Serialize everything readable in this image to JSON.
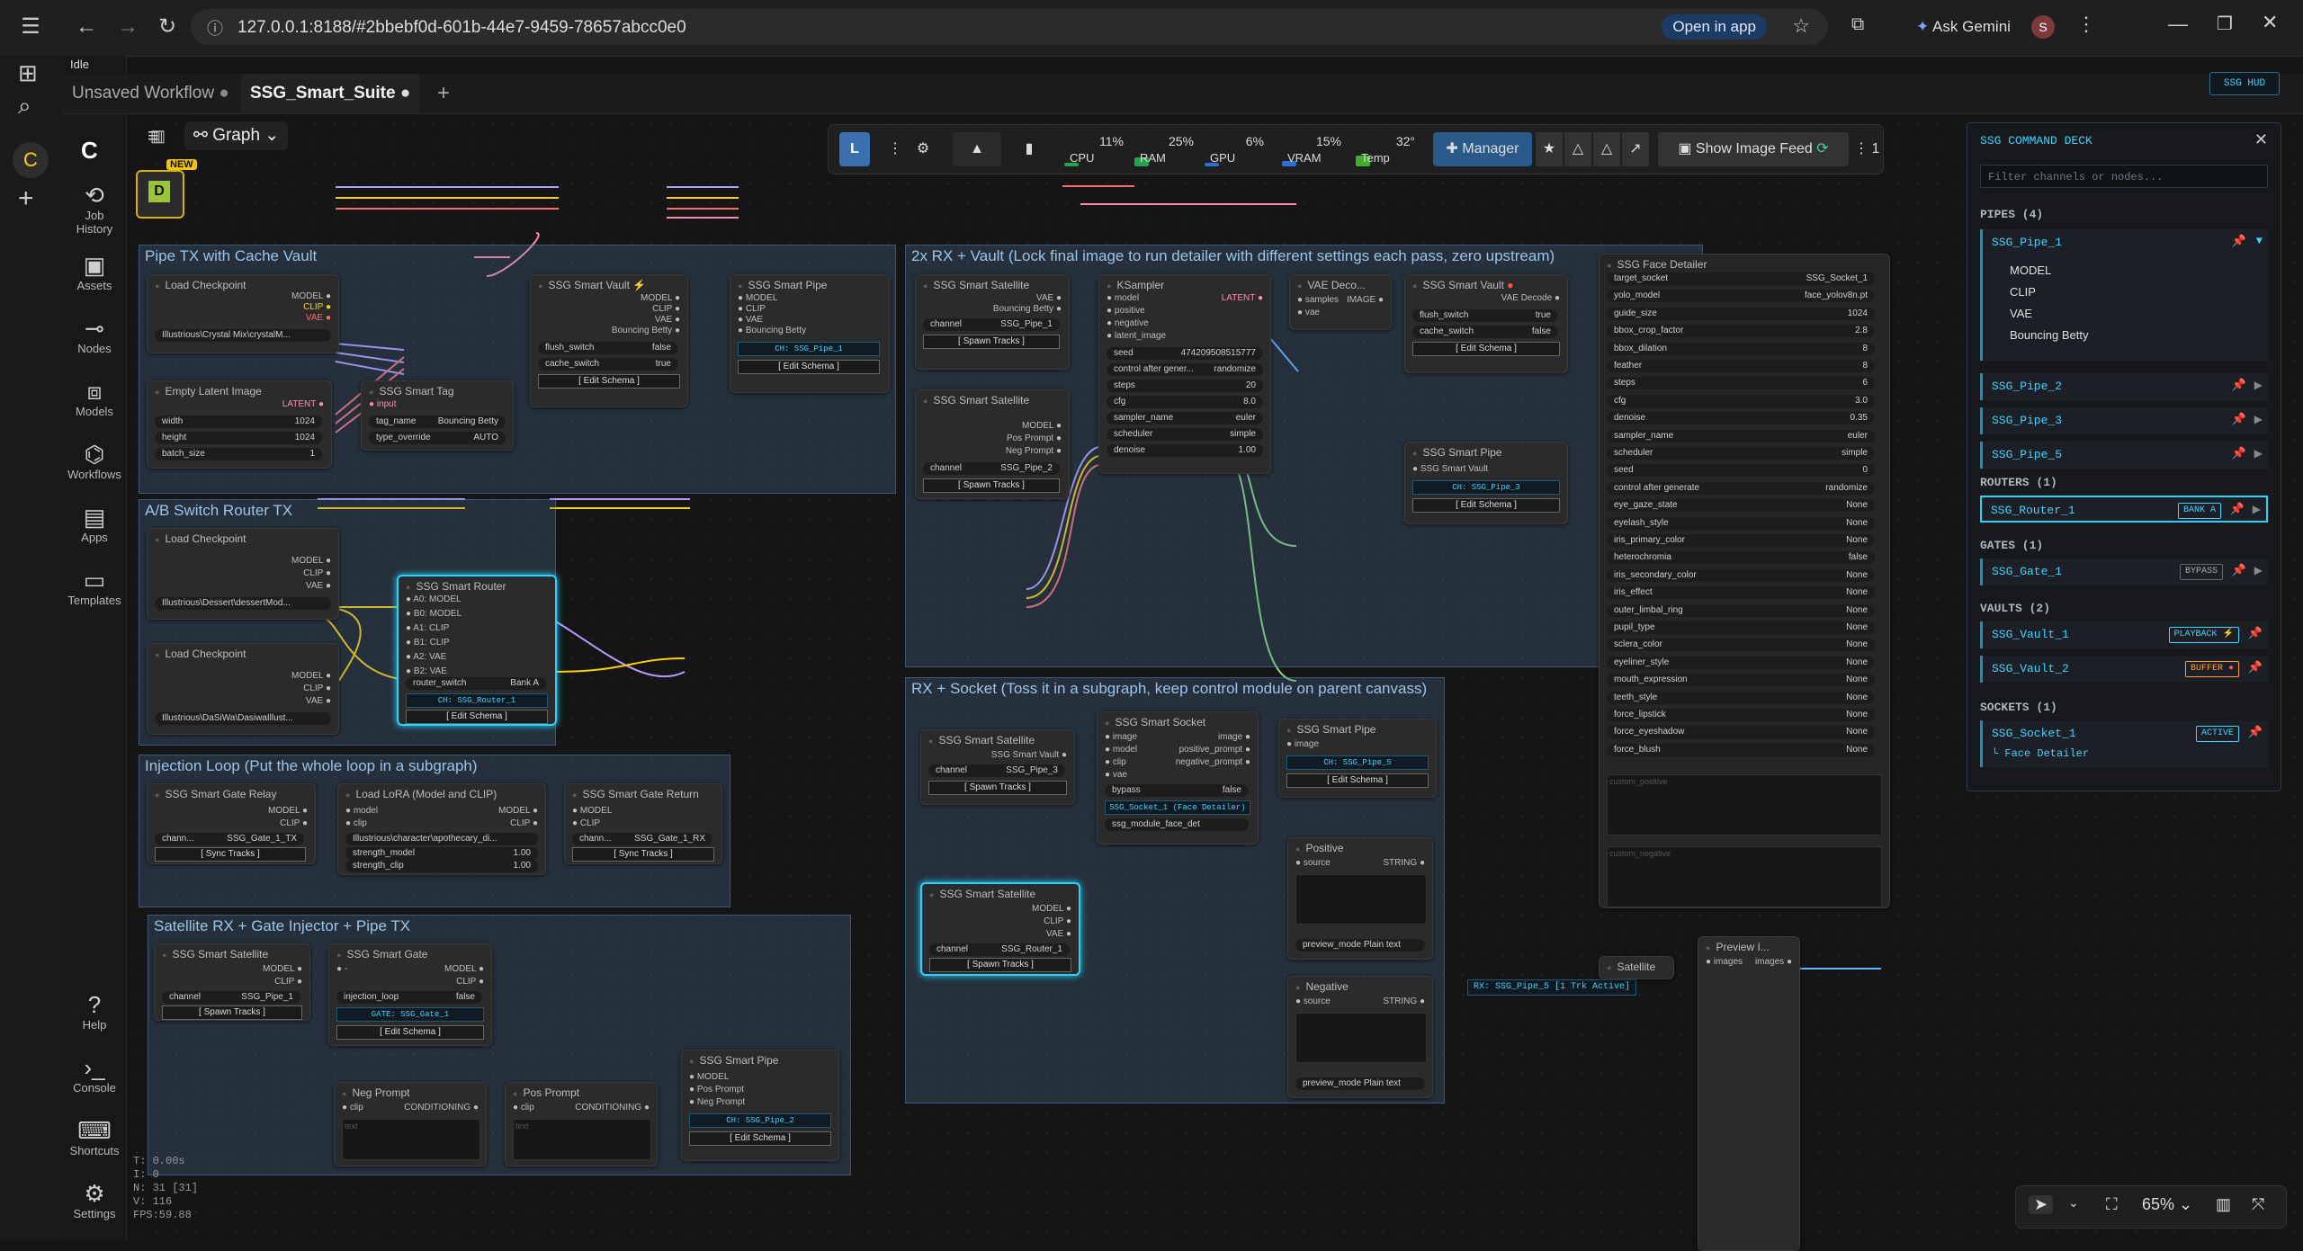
{
  "browser": {
    "url": "127.0.0.1:8188/#2bbebf0d-601b-44e7-9459-78657abcc0e0",
    "open_in_app": "Open in app",
    "ask_gemini": "Ask Gemini",
    "avatar": "S"
  },
  "status": {
    "idle": "Idle"
  },
  "tabs": [
    {
      "label": "Unsaved Workflow"
    },
    {
      "label": "SSG_Smart_Suite"
    }
  ],
  "graph_label": "Graph",
  "new_badge": "NEW",
  "sidebar": [
    {
      "label": "Job\nHistory",
      "icon": "history-icon"
    },
    {
      "label": "Assets",
      "icon": "image-icon"
    },
    {
      "label": "Nodes",
      "icon": "nodes-icon"
    },
    {
      "label": "Models",
      "icon": "models-icon"
    },
    {
      "label": "Workflows",
      "icon": "workflow-icon"
    },
    {
      "label": "Apps",
      "icon": "apps-icon"
    },
    {
      "label": "Templates",
      "icon": "templates-icon"
    },
    {
      "label": "Help",
      "icon": "help-icon"
    },
    {
      "label": "Console",
      "icon": "console-icon"
    },
    {
      "label": "Shortcuts",
      "icon": "keyboard-icon"
    },
    {
      "label": "Settings",
      "icon": "gear-icon"
    }
  ],
  "toolbar": {
    "l_label": "L",
    "cpu": {
      "label": "CPU",
      "value": "11%",
      "fill": 0.11
    },
    "ram": {
      "label": "RAM",
      "value": "25%",
      "fill": 0.25
    },
    "gpu": {
      "label": "GPU",
      "value": "6%",
      "fill": 0.06
    },
    "vram": {
      "label": "VRAM",
      "value": "15%",
      "fill": 0.15
    },
    "temp": {
      "label": "Temp",
      "value": "32°",
      "fill": 0.32
    },
    "manager": "Manager",
    "show_feed": "Show Image Feed",
    "queue": "1"
  },
  "hud": "SSG HUD",
  "groups": [
    {
      "id": "g1",
      "title": "Pipe TX with Cache Vault"
    },
    {
      "id": "g2",
      "title": "2x RX + Vault (Lock final image to run detailer with different settings each pass, zero upstream)"
    },
    {
      "id": "g3",
      "title": "A/B Switch Router TX"
    },
    {
      "id": "g4",
      "title": "Injection Loop (Put the whole loop in a subgraph)"
    },
    {
      "id": "g5",
      "title": "RX + Socket (Toss it in a subgraph, keep control module on parent canvass)"
    },
    {
      "id": "g6",
      "title": "Satellite RX + Gate Injector + Pipe TX"
    }
  ],
  "nodes": {
    "lc1": {
      "title": "Load Checkpoint",
      "ckpt": "Illustrious\\Crystal Mix\\crystalM..."
    },
    "empty": {
      "title": "Empty Latent Image",
      "width": "1024",
      "height": "1024",
      "batch": "1"
    },
    "tag": {
      "title": "SSG Smart Tag",
      "tag_name": "Bouncing Betty",
      "type_override": "AUTO"
    },
    "vault1": {
      "title": "SSG Smart Vault",
      "flush": "false",
      "cache": "true",
      "schema": "[ Edit Schema ]"
    },
    "pipe1": {
      "title": "SSG Smart Pipe",
      "ch": "CH: SSG_Pipe_1",
      "schema": "[ Edit Schema ]"
    },
    "sat_a": {
      "title": "SSG Smart Satellite",
      "channel": "SSG_Pipe_1",
      "spawn": "[ Spawn Tracks ]"
    },
    "sat_b": {
      "title": "SSG Smart Satellite",
      "channel": "SSG_Pipe_2",
      "spawn": "[ Spawn Tracks ]"
    },
    "ksampler": {
      "title": "KSampler",
      "seed": "474209508515777",
      "control": "randomize",
      "steps": "20",
      "cfg": "8.0",
      "sampler": "euler",
      "scheduler": "simple",
      "denoise": "1.00"
    },
    "vaedec": {
      "title": "VAE Deco..."
    },
    "vault2": {
      "title": "SSG Smart Vault",
      "flush": "true",
      "cache": "false",
      "schema": "[ Edit Schema ]"
    },
    "pipe3": {
      "title": "SSG Smart Pipe",
      "ch": "CH: SSG_Pipe_3",
      "schema": "[ Edit Schema ]"
    },
    "lc2": {
      "title": "Load Checkpoint",
      "ckpt": "Illustrious\\Dessert\\dessertMod..."
    },
    "lc3": {
      "title": "Load Checkpoint",
      "ckpt": "Illustrious\\DaSiWa\\DasiwaIllust..."
    },
    "router": {
      "title": "SSG Smart Router",
      "switch": "Bank A",
      "ch": "CH: SSG_Router_1",
      "schema": "[ Edit Schema ]"
    },
    "relay": {
      "title": "SSG Smart Gate Relay",
      "channel": "SSG_Gate_1_TX",
      "sync": "[ Sync Tracks ]"
    },
    "lora": {
      "title": "Load LoRA (Model and CLIP)",
      "lora": "Illustrious\\character\\apothecary_di...",
      "sm": "1.00",
      "sc": "1.00"
    },
    "gret": {
      "title": "SSG Smart Gate Return",
      "channel": "SSG_Gate_1_RX",
      "sync": "[ Sync Tracks ]"
    },
    "sat_c": {
      "title": "SSG Smart Satellite",
      "channel": "SSG_Pipe_3",
      "spawn": "[ Spawn Tracks ]"
    },
    "socket": {
      "title": "SSG Smart Socket",
      "bypass": "false",
      "ch": "SSG_Socket_1 (Face Detailer)",
      "module": "ssg_module_face_det"
    },
    "pipe5": {
      "title": "SSG Smart Pipe",
      "ch": "CH: SSG_Pipe_5",
      "schema": "[ Edit Schema ]"
    },
    "sat_d": {
      "title": "SSG Smart Satellite",
      "channel": "SSG_Router_1",
      "spawn": "[ Spawn Tracks ]"
    },
    "positive": {
      "title": "Positive",
      "preview": "preview_mode Plain text"
    },
    "negative": {
      "title": "Negative",
      "preview": "preview_mode Plain text"
    },
    "sat_e": {
      "title": "SSG Smart Satellite",
      "channel": "SSG_Pipe_1",
      "spawn": "[ Spawn Tracks ]"
    },
    "gate": {
      "title": "SSG Smart Gate",
      "injection": "false",
      "ch": "GATE: SSG_Gate_1",
      "schema": "[ Edit Schema ]"
    },
    "negp": {
      "title": "Neg Prompt"
    },
    "posp": {
      "title": "Pos Prompt"
    },
    "pipe2": {
      "title": "SSG Smart Pipe",
      "ch": "CH: SSG_Pipe_2",
      "schema": "[ Edit Schema ]"
    },
    "satsmall": {
      "title": "Satellite",
      "badge": "RX: SSG_Pipe_5 [1 Trk Active]"
    },
    "preview": {
      "title": "Preview I..."
    }
  },
  "face_detailer": {
    "title": "SSG Face Detailer",
    "rows": [
      [
        "target_socket",
        "SSG_Socket_1"
      ],
      [
        "yolo_model",
        "face_yolov8n.pt"
      ],
      [
        "guide_size",
        "1024"
      ],
      [
        "bbox_crop_factor",
        "2.8"
      ],
      [
        "bbox_dilation",
        "8"
      ],
      [
        "feather",
        "8"
      ],
      [
        "steps",
        "6"
      ],
      [
        "cfg",
        "3.0"
      ],
      [
        "denoise",
        "0.35"
      ],
      [
        "sampler_name",
        "euler"
      ],
      [
        "scheduler",
        "simple"
      ],
      [
        "seed",
        "0"
      ],
      [
        "control after generate",
        "randomize"
      ],
      [
        "eye_gaze_state",
        "None"
      ],
      [
        "eyelash_style",
        "None"
      ],
      [
        "iris_primary_color",
        "None"
      ],
      [
        "heterochromia",
        "false"
      ],
      [
        "iris_secondary_color",
        "None"
      ],
      [
        "iris_effect",
        "None"
      ],
      [
        "outer_limbal_ring",
        "None"
      ],
      [
        "pupil_type",
        "None"
      ],
      [
        "sclera_color",
        "None"
      ],
      [
        "eyeliner_style",
        "None"
      ],
      [
        "mouth_expression",
        "None"
      ],
      [
        "teeth_style",
        "None"
      ],
      [
        "force_lipstick",
        "None"
      ],
      [
        "force_eyeshadow",
        "None"
      ],
      [
        "force_blush",
        "None"
      ]
    ],
    "custom_positive": "custom_positive",
    "custom_negative": "custom_negative"
  },
  "deck": {
    "title": "SSG COMMAND DECK",
    "filter_placeholder": "Filter channels or nodes...",
    "pipes_header": "PIPES (4)",
    "pipes": [
      "SSG_Pipe_1",
      "SSG_Pipe_2",
      "SSG_Pipe_3",
      "SSG_Pipe_5"
    ],
    "pipe1_items": [
      "MODEL",
      "CLIP",
      "VAE",
      "Bouncing Betty"
    ],
    "routers_header": "ROUTERS (1)",
    "router": "SSG_Router_1",
    "router_badge": "BANK A",
    "gates_header": "GATES (1)",
    "gate": "SSG_Gate_1",
    "gate_badge": "BYPASS",
    "vaults_header": "VAULTS (2)",
    "vault1": "SSG_Vault_1",
    "vault1_badge": "PLAYBACK",
    "vault2": "SSG_Vault_2",
    "vault2_badge": "BUFFER",
    "sockets_header": "SOCKETS (1)",
    "socket": "SSG_Socket_1",
    "socket_badge": "ACTIVE",
    "socket_sub": "└ Face Detailer"
  },
  "stats": {
    "t": "T: 0.00s",
    "i": "I: 0",
    "n": "N: 31 [31]",
    "v": "V: 116",
    "fps": "FPS:59.88"
  },
  "zoom": "65%"
}
